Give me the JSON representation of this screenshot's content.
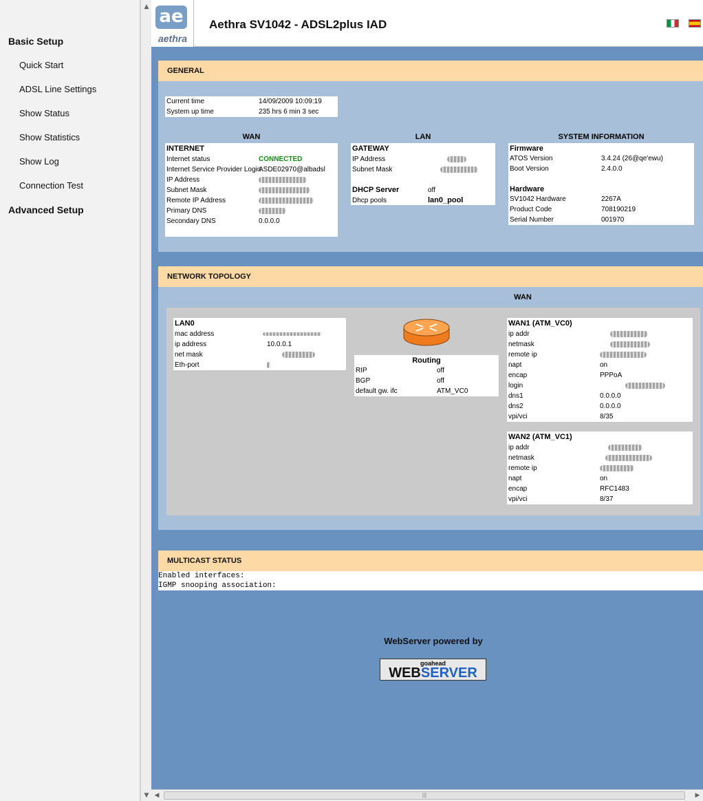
{
  "nav": {
    "basic_setup": "Basic Setup",
    "items": [
      "Quick Start",
      "ADSL Line Settings",
      "Show Status",
      "Show Statistics",
      "Show Log",
      "Connection Test"
    ],
    "advanced_setup": "Advanced Setup"
  },
  "header": {
    "logo_mark": "ae",
    "logo_word": "aethra",
    "title": "Aethra SV1042 - ADSL2plus IAD"
  },
  "general": {
    "title": "GENERAL",
    "current_time_label": "Current time",
    "current_time": "14/09/2009 10:09:19",
    "uptime_label": "System up time",
    "uptime": "235 hrs 6 min 3 sec",
    "wan": {
      "heading": "WAN",
      "section": "INTERNET",
      "internet_status_label": "Internet status",
      "internet_status": "CONNECTED",
      "isp_login_label": "Internet Service Provider Login",
      "isp_login": "ASDE02970@albadsl",
      "ip_label": "IP Address",
      "mask_label": "Subnet Mask",
      "remote_ip_label": "Remote IP Address",
      "pdns_label": "Primary DNS",
      "sdns_label": "Secondary DNS",
      "sdns": "0.0.0.0"
    },
    "lan": {
      "heading": "LAN",
      "section": "GATEWAY",
      "ip_label": "IP Address",
      "mask_label": "Subnet Mask",
      "dhcp_label": "DHCP Server",
      "dhcp_value": "off",
      "pools_label": "Dhcp pools",
      "pools_value": "lan0_pool"
    },
    "sysinfo": {
      "heading": "SYSTEM INFORMATION",
      "firmware": "Firmware",
      "atos_label": "ATOS Version",
      "atos": "3.4.24 (26@qe'ewu)",
      "boot_label": "Boot Version",
      "boot": "2.4.0.0",
      "hardware": "Hardware",
      "hw_label": "SV1042 Hardware",
      "hw": "2267A",
      "product_label": "Product Code",
      "product": "708190219",
      "serial_label": "Serial Number",
      "serial": "001970"
    }
  },
  "topology": {
    "title": "NETWORK TOPOLOGY",
    "wan_heading": "WAN",
    "lan0": {
      "title": "LAN0",
      "mac_label": "mac address",
      "ip_label": "ip address",
      "ip": "10.0.0.1",
      "mask_label": "net mask",
      "eth_label": "Eth-port"
    },
    "routing": {
      "title": "Routing",
      "rip_label": "RIP",
      "rip": "off",
      "bgp_label": "BGP",
      "bgp": "off",
      "gw_label": "default gw. ifc",
      "gw": "ATM_VC0"
    },
    "wan1": {
      "title": "WAN1 (ATM_VC0)",
      "ip_label": "ip addr",
      "mask_label": "netmask",
      "remote_label": "remote ip",
      "napt_label": "napt",
      "napt": "on",
      "encap_label": "encap",
      "encap": "PPPoA",
      "login_label": "login",
      "dns1_label": "dns1",
      "dns1": "0.0.0.0",
      "dns2_label": "dns2",
      "dns2": "0.0.0.0",
      "vpi_label": "vpi/vci",
      "vpi": "8/35"
    },
    "wan2": {
      "title": "WAN2 (ATM_VC1)",
      "ip_label": "ip addr",
      "mask_label": "netmask",
      "remote_label": "remote ip",
      "napt_label": "napt",
      "napt": "on",
      "encap_label": "encap",
      "encap": "RFC1483",
      "vpi_label": "vpi/vci",
      "vpi": "8/37"
    }
  },
  "multicast": {
    "title": "MULTICAST STATUS",
    "line1": "Enabled interfaces:",
    "line2": "IGMP snooping association:"
  },
  "footer": {
    "powered_by": "WebServer powered by",
    "badge_small": "goahead",
    "badge_web": "WEB",
    "badge_server": "SERVER"
  },
  "colors": {
    "background": "#6a92c0",
    "panel": "#a7bfd9",
    "panel_header": "#fdd9a5",
    "connected": "#1a8a1a"
  }
}
